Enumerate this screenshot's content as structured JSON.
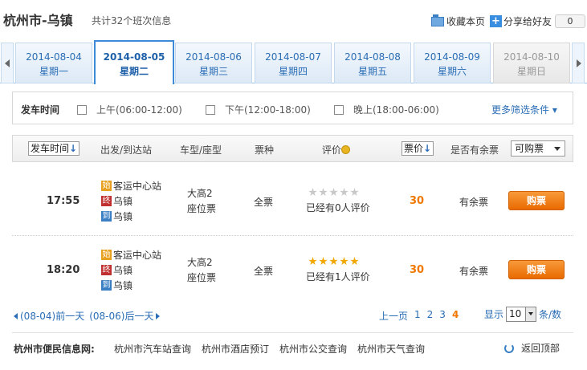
{
  "header": {
    "route": "杭州市-乌镇",
    "count_text": "共计32个班次信息",
    "favorite": "收藏本页",
    "share": "分享给好友",
    "share_count": "0"
  },
  "date_tabs": [
    {
      "date": "2014-08-04",
      "weekday": "星期一"
    },
    {
      "date": "2014-08-05",
      "weekday": "星期二"
    },
    {
      "date": "2014-08-06",
      "weekday": "星期三"
    },
    {
      "date": "2014-08-07",
      "weekday": "星期四"
    },
    {
      "date": "2014-08-08",
      "weekday": "星期五"
    },
    {
      "date": "2014-08-09",
      "weekday": "星期六"
    },
    {
      "date": "2014-08-10",
      "weekday": "星期日"
    }
  ],
  "filter": {
    "label": "发车时间",
    "options": [
      "上午(06:00-12:00)",
      "下午(12:00-18:00)",
      "晚上(18:00-06:00)"
    ],
    "more": "更多筛选条件"
  },
  "table": {
    "headers": {
      "time": "发车时间",
      "route": "出发/到达站",
      "bustype": "车型/座型",
      "ticket": "票种",
      "rating": "评价",
      "price": "票价",
      "seats": "是否有余票",
      "select": "可购票"
    },
    "rows": [
      {
        "time": "17:55",
        "start_tag": "始",
        "start": "客运中心站",
        "end_tag": "终",
        "end": "乌镇",
        "arrive_tag": "到",
        "arrive": "乌镇",
        "bus": "大高2",
        "seat": "座位票",
        "ticket": "全票",
        "stars": 0,
        "rating_text": "已经有0人评价",
        "price": "30",
        "seats": "有余票",
        "buy": "购票"
      },
      {
        "time": "18:20",
        "start_tag": "始",
        "start": "客运中心站",
        "end_tag": "终",
        "end": "乌镇",
        "arrive_tag": "到",
        "arrive": "乌镇",
        "bus": "大高2",
        "seat": "座位票",
        "ticket": "全票",
        "stars": 5,
        "rating_text": "已经有1人评价",
        "price": "30",
        "seats": "有余票",
        "buy": "购票"
      }
    ]
  },
  "pager": {
    "prev_day": "(08-04)前一天",
    "next_day": "(08-06)后一天",
    "prev_page": "上一页",
    "pages": [
      "1",
      "2",
      "3",
      "4"
    ],
    "show_label": "显示",
    "page_size": "10",
    "per_unit": "条/数"
  },
  "footer": {
    "label": "杭州市便民信息网:",
    "links": [
      "杭州市汽车站查询",
      "杭州市酒店预订",
      "杭州市公交查询",
      "杭州市天气查询"
    ],
    "back_top": "返回顶部"
  },
  "colors": {
    "accent": "#2a6db5",
    "price": "#f07800",
    "buy_button": "#e86a00"
  }
}
